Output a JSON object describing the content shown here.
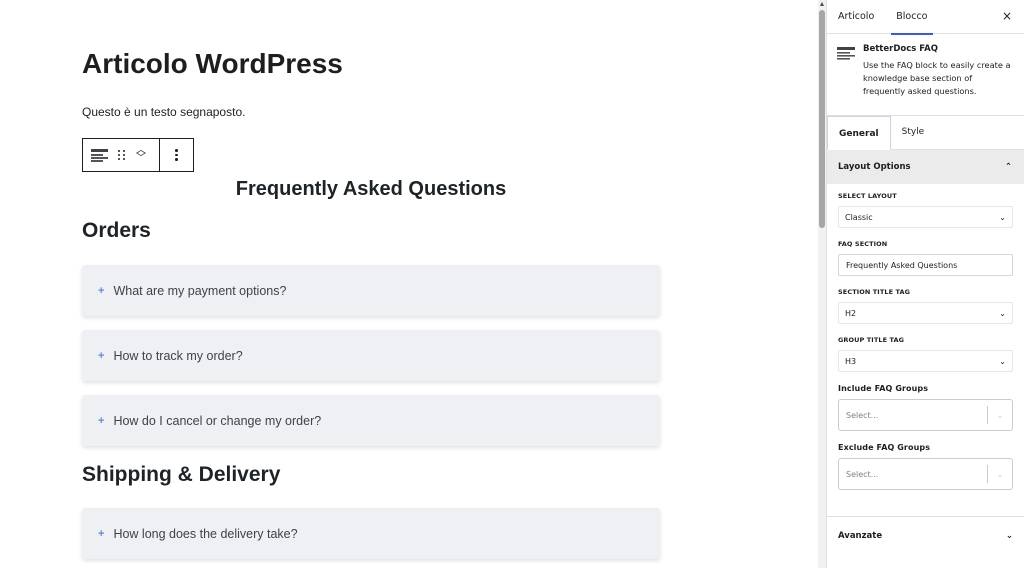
{
  "editor": {
    "post_title": "Articolo WordPress",
    "paragraph": "Questo è un testo segnaposto.",
    "faq_title": "Frequently Asked Questions",
    "groups": [
      {
        "title": "Orders",
        "items": [
          "What are my payment options?",
          "How to track my order?",
          "How do I cancel or change my order?"
        ]
      },
      {
        "title": "Shipping & Delivery",
        "items": [
          "How long does the delivery take?"
        ]
      }
    ],
    "item_marker": "+"
  },
  "sidebar": {
    "tabs": [
      "Articolo",
      "Blocco"
    ],
    "active_tab": "Blocco",
    "close": "×",
    "block": {
      "name": "BetterDocs FAQ",
      "description": "Use the FAQ block to easily create a knowledge base section of frequently asked questions."
    },
    "settings_tabs": [
      "General",
      "Style"
    ],
    "panel": {
      "title": "Layout Options",
      "select_layout_label": "SELECT LAYOUT",
      "select_layout_value": "Classic",
      "faq_section_label": "FAQ SECTION",
      "faq_section_value": "Frequently Asked Questions",
      "section_title_tag_label": "SECTION TITLE TAG",
      "section_title_tag_value": "H2",
      "group_title_tag_label": "GROUP TITLE TAG",
      "group_title_tag_value": "H3",
      "include_groups_label": "Include FAQ Groups",
      "include_groups_placeholder": "Select...",
      "exclude_groups_label": "Exclude FAQ Groups",
      "exclude_groups_placeholder": "Select..."
    },
    "advanced_label": "Avanzate"
  },
  "colors": {
    "accent": "#3858e9",
    "faq_marker": "#5b8fd6",
    "faq_item_bg": "#eff0f3"
  }
}
